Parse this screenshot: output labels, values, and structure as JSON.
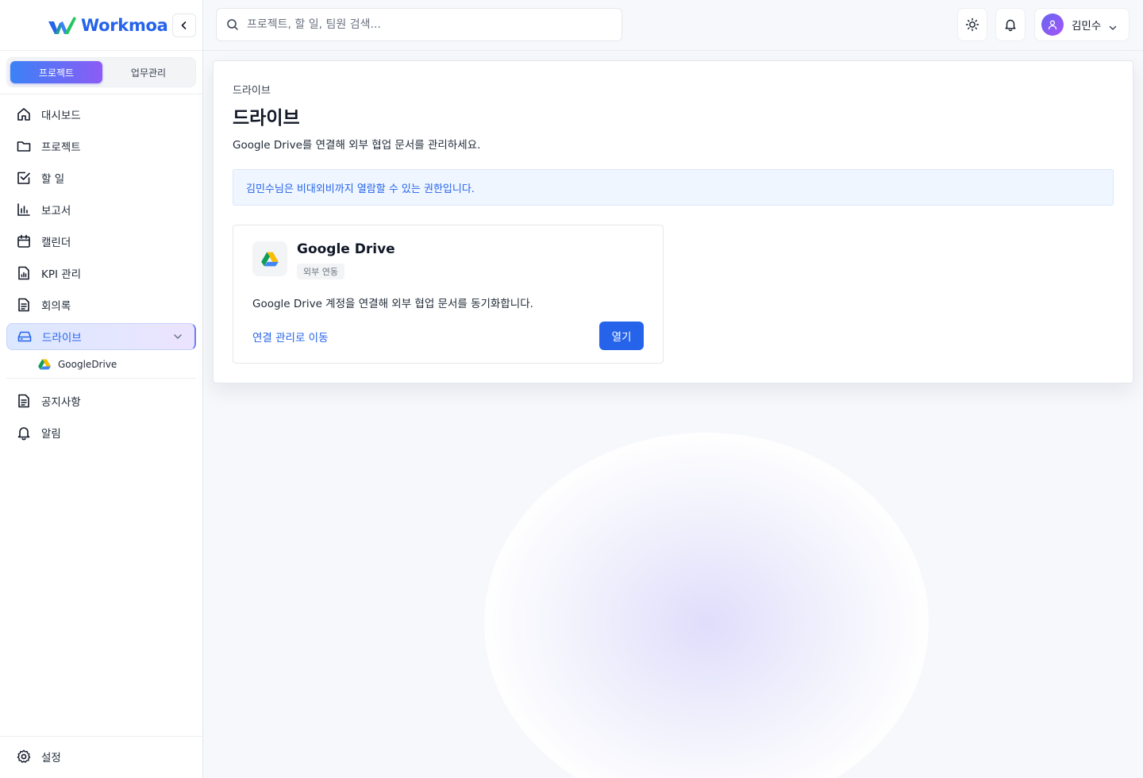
{
  "brand": {
    "name": "Workmoa",
    "color": "#2563eb"
  },
  "mode_switch": {
    "active": "프로젝트",
    "inactive": "업무관리"
  },
  "sidebar": {
    "items": [
      {
        "label": "대시보드",
        "icon": "home-icon"
      },
      {
        "label": "프로젝트",
        "icon": "folder-icon"
      },
      {
        "label": "할 일",
        "icon": "checkbox-icon"
      },
      {
        "label": "보고서",
        "icon": "bar-chart-icon"
      },
      {
        "label": "캘린더",
        "icon": "calendar-icon"
      },
      {
        "label": "KPI 관리",
        "icon": "kpi-file-icon"
      },
      {
        "label": "회의록",
        "icon": "document-icon"
      },
      {
        "label": "드라이브",
        "icon": "drive-icon",
        "active": true
      },
      {
        "label": "공지사항",
        "icon": "notice-icon"
      },
      {
        "label": "알림",
        "icon": "bell-icon"
      }
    ],
    "drive_sub": {
      "label": "GoogleDrive",
      "icon": "google-drive-icon"
    },
    "settings_label": "설정"
  },
  "header": {
    "search_placeholder": "프로젝트, 할 일, 팀원 검색...",
    "user_name": "김민수"
  },
  "page": {
    "breadcrumb": "드라이브",
    "title": "드라이브",
    "description": "Google Drive를 연결해 외부 협업 문서를 관리하세요.",
    "notice": "김민수님은 비대외비까지 열람할 수 있는 권한입니다."
  },
  "card": {
    "title": "Google Drive",
    "badge": "외부 연동",
    "description": "Google Drive 계정을 연결해 외부 협업 문서를 동기화합니다.",
    "link": "연결 관리로 이동",
    "button": "열기"
  },
  "colors": {
    "accent": "#2563eb",
    "gradient_start": "#3b82f6",
    "gradient_end": "#8b5cf6",
    "notice_bg": "#eff6ff"
  }
}
